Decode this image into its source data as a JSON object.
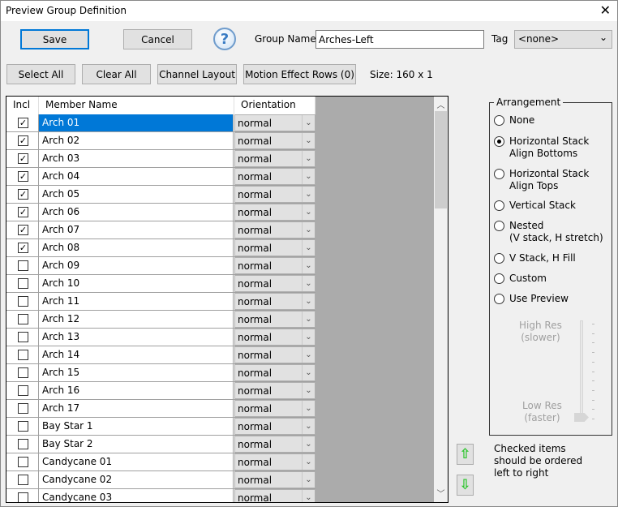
{
  "window": {
    "title": "Preview Group Definition",
    "close": "✕"
  },
  "toolbar": {
    "save": "Save",
    "cancel": "Cancel",
    "help": "?",
    "group_name_label": "Group Name",
    "group_name_value": "Arches-Left",
    "tag_label": "Tag",
    "tag_value": "<none>"
  },
  "actions": {
    "select_all": "Select All",
    "clear_all": "Clear All",
    "channel_layout": "Channel Layout",
    "motion_effect_rows": "Motion Effect Rows (0)",
    "size": "Size: 160 x 1"
  },
  "grid": {
    "headers": [
      "Incl",
      "Member Name",
      "Orientation"
    ],
    "rows": [
      {
        "name": "Arch 01",
        "checked": true,
        "orientation": "normal",
        "selected": true
      },
      {
        "name": "Arch 02",
        "checked": true,
        "orientation": "normal"
      },
      {
        "name": "Arch 03",
        "checked": true,
        "orientation": "normal"
      },
      {
        "name": "Arch 04",
        "checked": true,
        "orientation": "normal"
      },
      {
        "name": "Arch 05",
        "checked": true,
        "orientation": "normal"
      },
      {
        "name": "Arch 06",
        "checked": true,
        "orientation": "normal"
      },
      {
        "name": "Arch 07",
        "checked": true,
        "orientation": "normal"
      },
      {
        "name": "Arch 08",
        "checked": true,
        "orientation": "normal"
      },
      {
        "name": "Arch 09",
        "checked": false,
        "orientation": "normal"
      },
      {
        "name": "Arch 10",
        "checked": false,
        "orientation": "normal"
      },
      {
        "name": "Arch 11",
        "checked": false,
        "orientation": "normal"
      },
      {
        "name": "Arch 12",
        "checked": false,
        "orientation": "normal"
      },
      {
        "name": "Arch 13",
        "checked": false,
        "orientation": "normal"
      },
      {
        "name": "Arch 14",
        "checked": false,
        "orientation": "normal"
      },
      {
        "name": "Arch 15",
        "checked": false,
        "orientation": "normal"
      },
      {
        "name": "Arch 16",
        "checked": false,
        "orientation": "normal"
      },
      {
        "name": "Arch 17",
        "checked": false,
        "orientation": "normal"
      },
      {
        "name": "Bay Star 1",
        "checked": false,
        "orientation": "normal"
      },
      {
        "name": "Bay Star 2",
        "checked": false,
        "orientation": "normal"
      },
      {
        "name": "Candycane 01",
        "checked": false,
        "orientation": "normal"
      },
      {
        "name": "Candycane 02",
        "checked": false,
        "orientation": "normal"
      },
      {
        "name": "Candycane 03",
        "checked": false,
        "orientation": "normal"
      }
    ]
  },
  "arrangement": {
    "label": "Arrangement",
    "options": [
      {
        "label": "None",
        "selected": false
      },
      {
        "label": "Horizontal Stack\nAlign Bottoms",
        "selected": true
      },
      {
        "label": "Horizontal Stack\nAlign Tops",
        "selected": false
      },
      {
        "label": "Vertical Stack",
        "selected": false
      },
      {
        "label": "Nested\n(V stack, H stretch)",
        "selected": false
      },
      {
        "label": "V Stack, H Fill",
        "selected": false
      },
      {
        "label": "Custom",
        "selected": false
      },
      {
        "label": "Use Preview",
        "selected": false
      }
    ],
    "high_res": "High Res\n(slower)",
    "low_res": "Low Res\n(faster)",
    "resolution_level": 0
  },
  "order_note": "Checked items\nshould be ordered\nleft to right",
  "colors": {
    "accent": "#0078d7",
    "arrow": "#2cc52c"
  }
}
